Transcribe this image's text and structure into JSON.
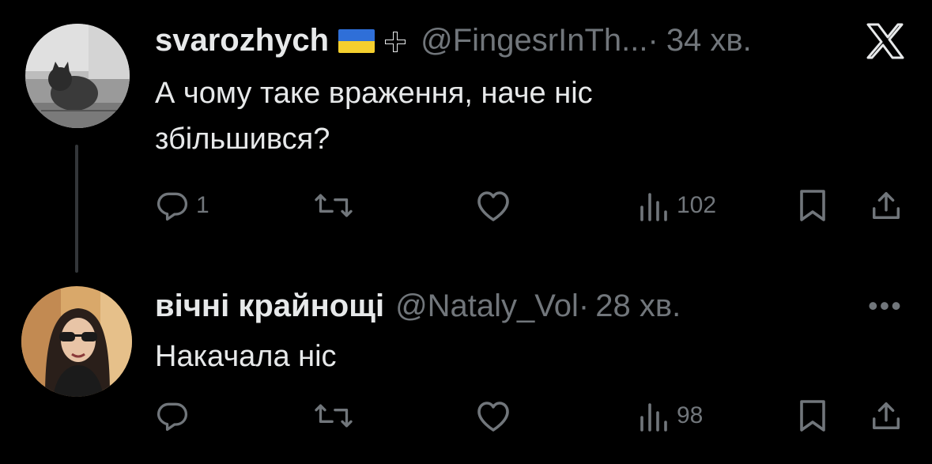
{
  "tweets": [
    {
      "name": "svarozhych",
      "handle": "@FingesrInTh...",
      "separator": "·",
      "time": "34 хв.",
      "text_line1": "А чому таке враження, наче ніс",
      "text_line2": "збільшився?",
      "replies": "1",
      "retweets": "",
      "likes": "",
      "views": "102",
      "avatar_icon": "cat-photo-avatar",
      "badges": [
        "ukraine-flag-icon",
        "cross-icon"
      ]
    },
    {
      "name": "вічні крайнощі",
      "handle": "@Nataly_Vol",
      "separator": "·",
      "time": "28 хв.",
      "text_line1": "Накачала ніс",
      "replies": "",
      "retweets": "",
      "likes": "",
      "views": "98",
      "avatar_icon": "woman-photo-avatar"
    }
  ],
  "colors": {
    "background": "#000000",
    "text": "#e7e9ea",
    "muted": "#71767b",
    "flag_blue": "#2f6fd8",
    "flag_yellow": "#f4cf2e"
  },
  "icons": {
    "top_right": "x-logo-icon",
    "more": "more-dots-icon",
    "more_label": "•••"
  }
}
